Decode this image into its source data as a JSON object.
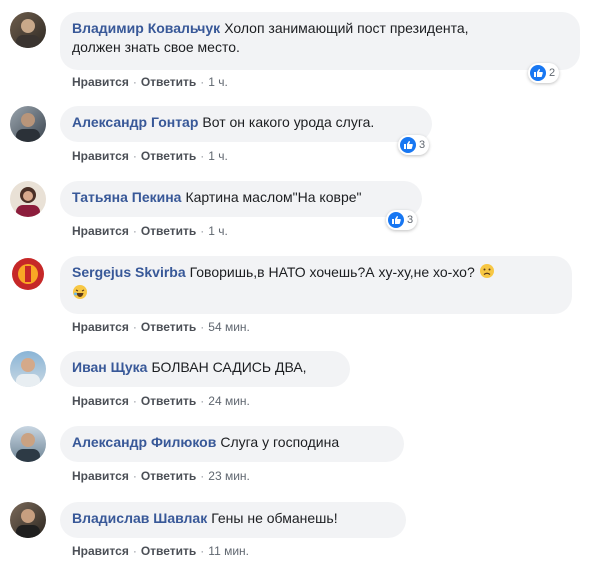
{
  "colors": {
    "author": "#385898",
    "bubble": "#f2f3f5",
    "action": "#4b4f56",
    "like": "#1877f2"
  },
  "labels": {
    "like": "Нравится",
    "reply": "Ответить",
    "separator": "·"
  },
  "comments": [
    {
      "author": "Владимир Ковальчук",
      "text_line1": "Холоп занимающий пост президента,",
      "text_line2": "должен знать свое место.",
      "time": "1 ч.",
      "reactions": "2",
      "reaction_icon": "like-icon"
    },
    {
      "author": "Александр Гонтар",
      "text": "Вот он какого урода слуга.",
      "time": "1 ч.",
      "reactions": "3",
      "reaction_icon": "like-icon"
    },
    {
      "author": "Татьяна Пекина",
      "text": "Картина маслом\"На ковре\"",
      "time": "1 ч.",
      "reactions": "3",
      "reaction_icon": "like-icon"
    },
    {
      "author": "Sergejus Skvirba",
      "text": "Говоришь,в НАТО хочешь?А ху-ху,не хо-хо?",
      "time": "54 мин.",
      "emoji": [
        "sad-face-icon",
        "laughing-face-icon"
      ]
    },
    {
      "author": "Иван Щука",
      "text": "БОЛВАН САДИСЬ ДВА,",
      "time": "24 мин."
    },
    {
      "author": "Александр Филюков",
      "text": "Слуга у господина",
      "time": "23 мин."
    },
    {
      "author": "Владислав Шавлак",
      "text": "Гены не обманешь!",
      "time": "11 мин."
    }
  ]
}
